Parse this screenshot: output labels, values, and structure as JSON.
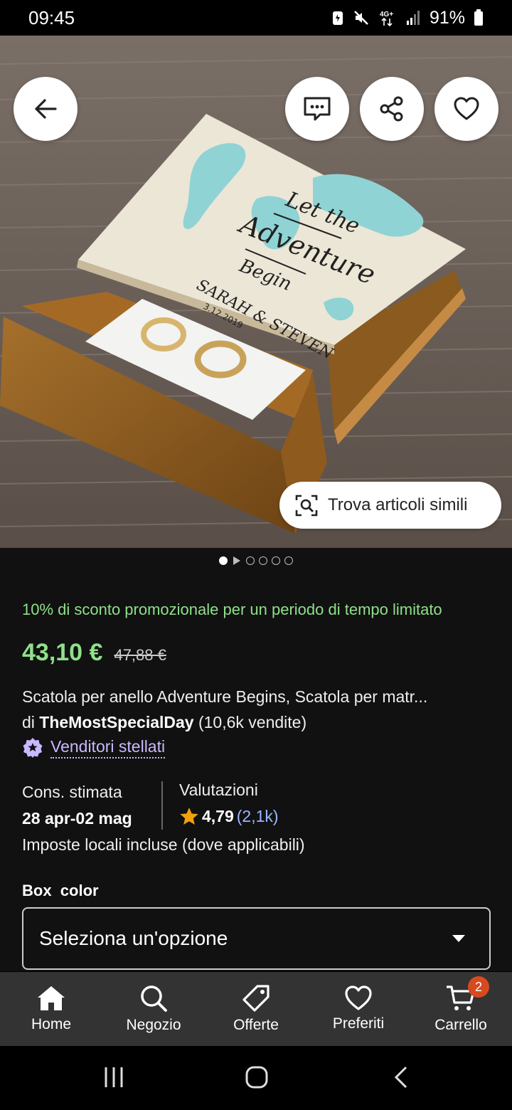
{
  "status_bar": {
    "time": "09:45",
    "battery": "91%",
    "network": "4G+"
  },
  "hero": {
    "image_text": [
      "Let the",
      "Adventure",
      "Begin",
      "SARAH & STEVEN",
      "3.12.2019"
    ],
    "similar_label": "Trova articoli simili",
    "gallery_count": 6,
    "gallery_active": 0
  },
  "product": {
    "promo": "10% di sconto promozionale per un periodo di tempo limitato",
    "price": "43,10 €",
    "old_price": "47,88 €",
    "title": "Scatola per anello Adventure Begins, Scatola per matr...",
    "by": "di",
    "shop": "TheMostSpecialDay",
    "sales": "(10,6k vendite)",
    "star_seller": "Venditori stellati",
    "shipping_label": "Cons. stimata",
    "shipping_value": "28 apr-02 mag",
    "rating_label": "Valutazioni",
    "rating_value": "4,79",
    "rating_count": "(2,1k)",
    "tax_note": "Imposte locali incluse (dove applicabili)",
    "option_label": "Box  color",
    "option_placeholder": "Seleziona un'opzione"
  },
  "bottom_nav": {
    "items": [
      {
        "label": "Home",
        "icon": "home-icon"
      },
      {
        "label": "Negozio",
        "icon": "search-icon"
      },
      {
        "label": "Offerte",
        "icon": "tag-icon"
      },
      {
        "label": "Preferiti",
        "icon": "heart-icon"
      },
      {
        "label": "Carrello",
        "icon": "cart-icon"
      }
    ],
    "cart_badge": "2"
  },
  "colors": {
    "promo_green": "#8fe08a",
    "star_seller": "#c9b8ff",
    "rating_link": "#9ab7ff",
    "badge": "#d64a1f",
    "star": "#f1a10c"
  }
}
